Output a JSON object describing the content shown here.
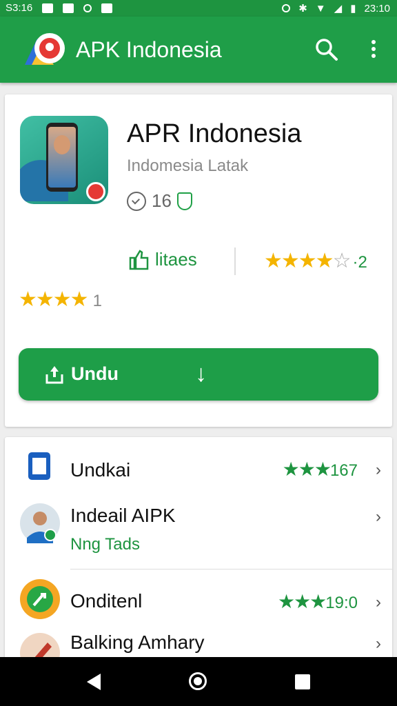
{
  "status_bar": {
    "time_left": "S3:16",
    "time_right": "23:10"
  },
  "appbar": {
    "title": "APK Indonesia",
    "brand_color": "#1f9e48"
  },
  "app": {
    "name": "APR Indonesia",
    "developer": "Indomesia Latak",
    "version": "16",
    "likes_label": "litaes",
    "rating_right_count": "·2",
    "rating_left_count": "1",
    "download_label": "Undu",
    "download_arrow": "↓"
  },
  "list": [
    {
      "title": "Undkai",
      "rating_text": "★★★",
      "count": "167",
      "chevron": "›",
      "icon": "document-icon"
    },
    {
      "title": "Indeail AIPK",
      "subtitle": "Nng Tads",
      "chevron": "›",
      "icon": "avatar-icon"
    },
    {
      "title": "Onditenl",
      "rating_text": "★★★",
      "count": "19:0",
      "chevron": "›",
      "icon": "app-icon-yellow"
    },
    {
      "title": "Balking Amhary",
      "chevron": "›",
      "icon": "brush-icon"
    }
  ],
  "colors": {
    "accent": "#1e9440",
    "star": "#f4b400"
  }
}
